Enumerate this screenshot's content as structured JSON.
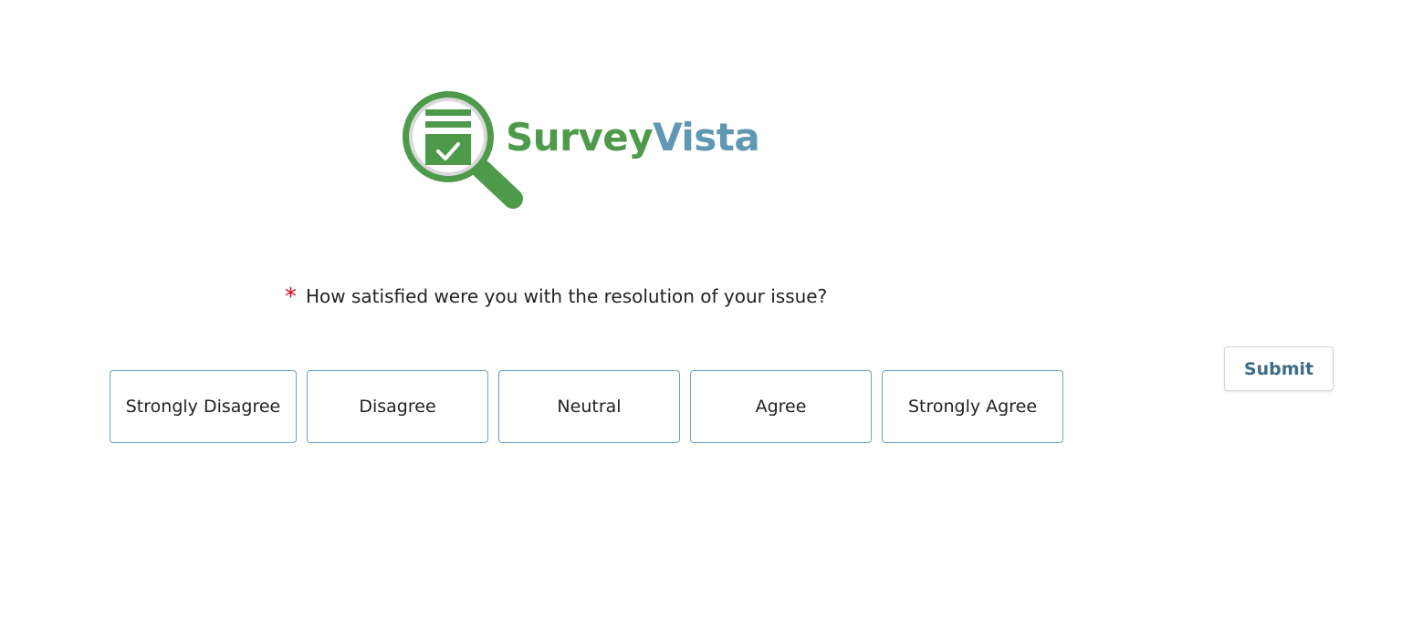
{
  "logo": {
    "word1": "Survey",
    "word2": "Vista",
    "green": "#4e9a4b",
    "blue": "#5f98b3"
  },
  "question": {
    "required_marker": "*",
    "text": "How satisfied were you with the resolution of your issue?"
  },
  "options": [
    {
      "label": "Strongly Disagree"
    },
    {
      "label": "Disagree"
    },
    {
      "label": "Neutral"
    },
    {
      "label": "Agree"
    },
    {
      "label": "Strongly Agree"
    }
  ],
  "submit": {
    "label": "Submit"
  },
  "colors": {
    "required": "#e0061b",
    "option_border": "#6ea2c0",
    "submit_text": "#3d6b85"
  },
  "icons": {
    "logo_mark": "magnifier-checklist-icon"
  }
}
